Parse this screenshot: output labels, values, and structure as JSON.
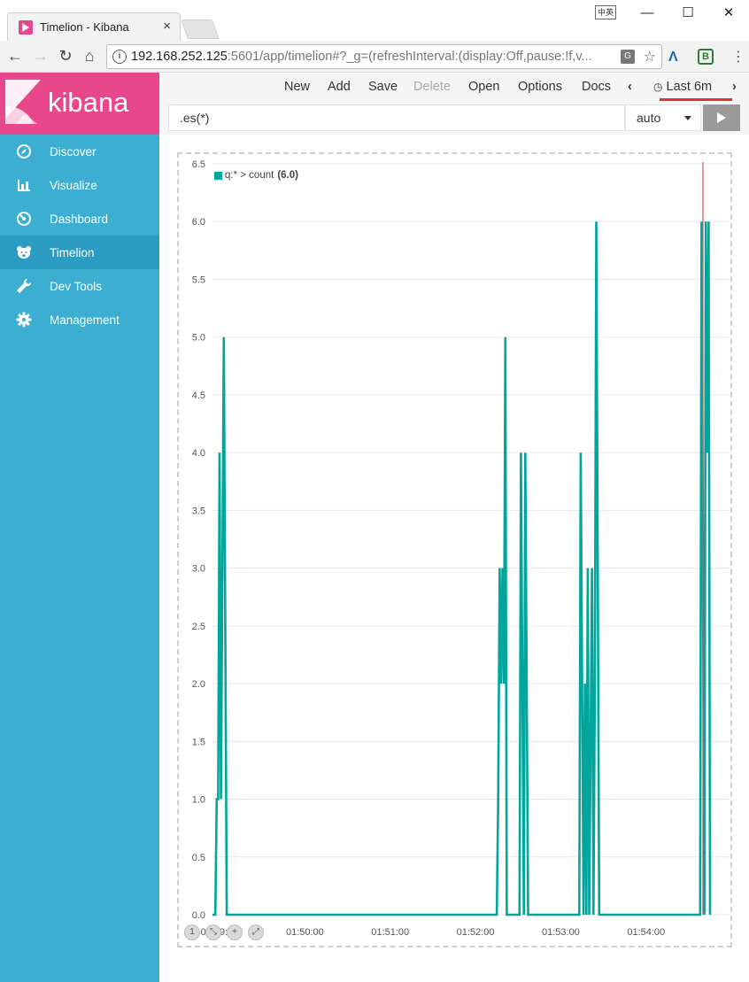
{
  "browser": {
    "tab_title": "Timelion - Kibana",
    "tab_close": "×",
    "url_host": "192.168.252.125",
    "url_rest": ":5601/app/timelion#?_g=(refreshInterval:(display:Off,pause:!f,v...",
    "ime_label": "中英",
    "window_controls": [
      "—",
      "☐",
      "✕"
    ]
  },
  "brand": {
    "name": "kibana"
  },
  "sidebar": {
    "items": [
      {
        "label": "Discover",
        "icon": "compass-icon"
      },
      {
        "label": "Visualize",
        "icon": "bar-chart-icon"
      },
      {
        "label": "Dashboard",
        "icon": "dashboard-icon"
      },
      {
        "label": "Timelion",
        "icon": "bear-icon",
        "active": true
      },
      {
        "label": "Dev Tools",
        "icon": "wrench-icon"
      },
      {
        "label": "Management",
        "icon": "gear-icon"
      }
    ]
  },
  "menu": {
    "new": "New",
    "add": "Add",
    "save": "Save",
    "delete": "Delete",
    "open": "Open",
    "options": "Options",
    "docs": "Docs",
    "time_range": "Last 6m"
  },
  "query": {
    "expression": ".es(*)",
    "interval": "auto"
  },
  "legend": {
    "label": "q:* > count",
    "value": "(6.0)"
  },
  "colors": {
    "series": "#00a69b",
    "cursor": "#d9534f",
    "sidebar": "#3caed2",
    "brand": "#e8488b"
  },
  "chart_data": {
    "type": "line",
    "series": [
      {
        "name": "q:* > count",
        "points": [
          [
            "01:48:55",
            0
          ],
          [
            "01:48:57",
            0
          ],
          [
            "01:48:58",
            1
          ],
          [
            "01:48:59",
            1
          ],
          [
            "01:49:00",
            4
          ],
          [
            "01:49:01",
            1
          ],
          [
            "01:49:02",
            3
          ],
          [
            "01:49:03",
            5
          ],
          [
            "01:49:05",
            0
          ],
          [
            "01:52:15",
            0
          ],
          [
            "01:52:16",
            1
          ],
          [
            "01:52:17",
            3
          ],
          [
            "01:52:18",
            2
          ],
          [
            "01:52:19",
            3
          ],
          [
            "01:52:20",
            2
          ],
          [
            "01:52:21",
            5
          ],
          [
            "01:52:22",
            0
          ],
          [
            "01:52:31",
            0
          ],
          [
            "01:52:32",
            4
          ],
          [
            "01:52:34",
            0
          ],
          [
            "01:52:35",
            4
          ],
          [
            "01:52:37",
            0
          ],
          [
            "01:53:13",
            0
          ],
          [
            "01:53:14",
            4
          ],
          [
            "01:53:16",
            0
          ],
          [
            "01:53:17",
            2
          ],
          [
            "01:53:18",
            0
          ],
          [
            "01:53:19",
            3
          ],
          [
            "01:53:20",
            0
          ],
          [
            "01:53:22",
            3
          ],
          [
            "01:53:23",
            0
          ],
          [
            "01:53:24",
            2
          ],
          [
            "01:53:25",
            6
          ],
          [
            "01:53:27",
            0
          ],
          [
            "01:54:38",
            0
          ],
          [
            "01:54:39",
            6
          ],
          [
            "01:54:41",
            0
          ],
          [
            "01:54:42",
            6
          ],
          [
            "01:54:43",
            4
          ],
          [
            "01:54:44",
            6
          ],
          [
            "01:54:45",
            0
          ]
        ]
      }
    ],
    "x_ticks": [
      "01:49:00",
      "01:50:00",
      "01:51:00",
      "01:52:00",
      "01:53:00",
      "01:54:00"
    ],
    "y_ticks": [
      "0.0",
      "0.5",
      "1.0",
      "1.5",
      "2.0",
      "2.5",
      "3.0",
      "3.5",
      "4.0",
      "4.5",
      "5.0",
      "5.5",
      "6.0",
      "6.5"
    ],
    "xlim": [
      "01:48:55",
      "01:54:45"
    ],
    "ylim": [
      0,
      6.5
    ],
    "cursor_x": "01:54:40",
    "grid": true,
    "legend_position": "top-left"
  }
}
